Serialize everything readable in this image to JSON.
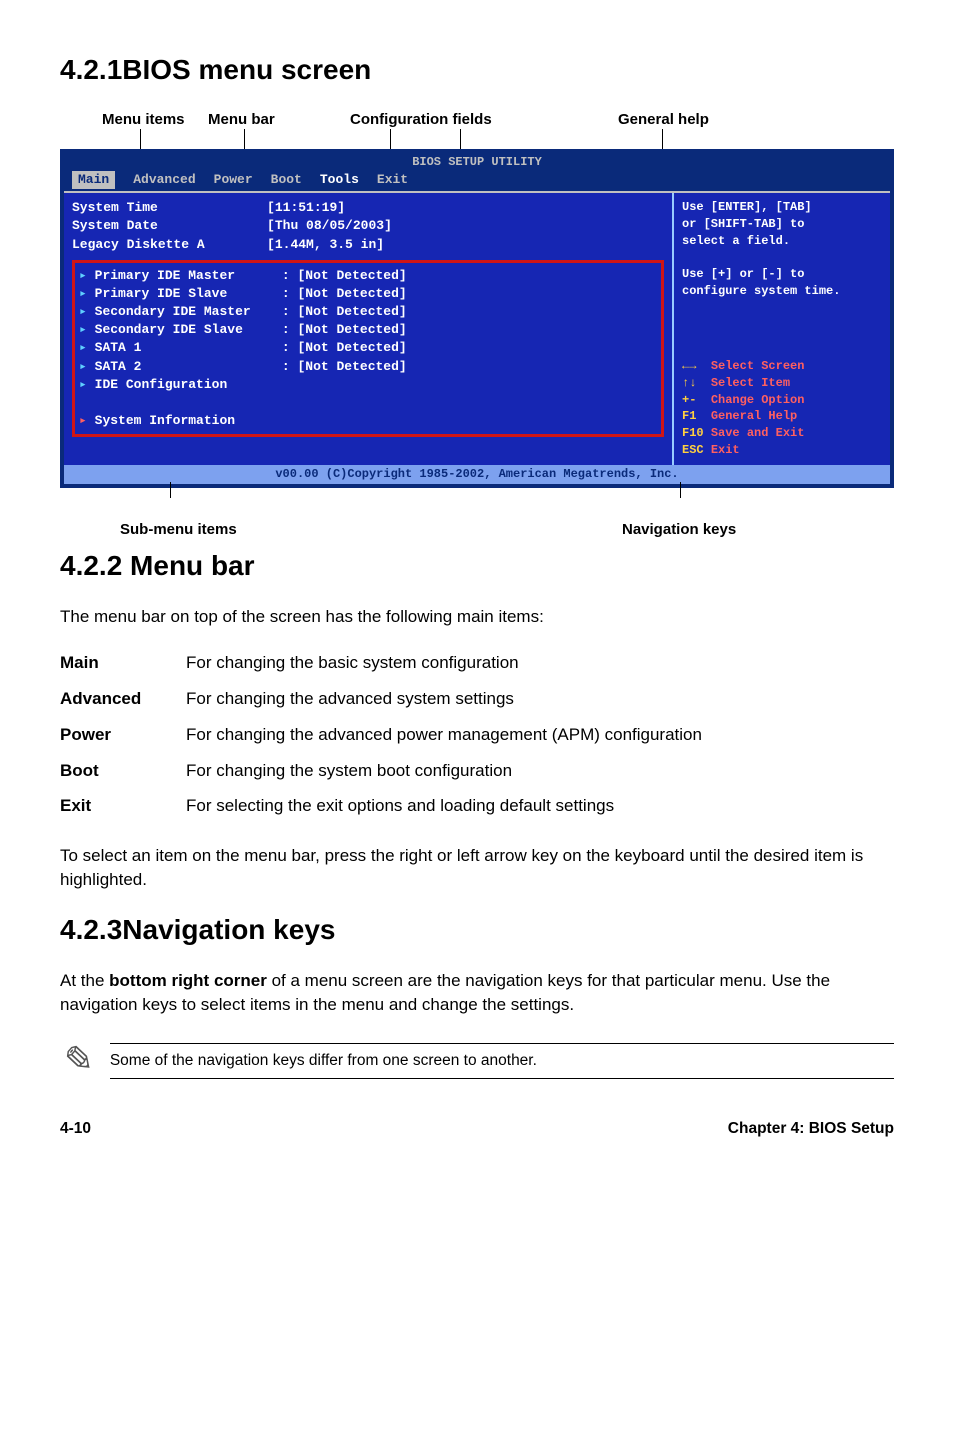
{
  "sections": {
    "s1_heading": "4.2.1BIOS menu screen",
    "s2_heading": "4.2.2  Menu bar",
    "s2_intro": "The menu bar on top of the screen has the following main items:",
    "s2_outro": "To select an item on the menu bar, press the right or left arrow key on the keyboard until the desired item is highlighted.",
    "s3_heading": "4.2.3Navigation keys",
    "s3_body": "At the bottom right corner of a menu screen are the navigation keys for that particular menu. Use the navigation keys to select items in the menu and change the settings.",
    "note": "Some of the navigation keys differ from one screen to another."
  },
  "labels": {
    "menu_items": "Menu items",
    "menu_bar": "Menu bar",
    "config_fields": "Configuration fields",
    "general_help": "General help",
    "submenu": "Sub-menu items",
    "navkeys": "Navigation keys"
  },
  "bios": {
    "title": "BIOS SETUP UTILITY",
    "menubar": [
      "Main",
      "Advanced",
      "Power",
      "Boot",
      "Tools",
      "Exit"
    ],
    "active_tab": "Main",
    "left_top": [
      {
        "label": "System Time",
        "value": "[11:51:19]"
      },
      {
        "label": "System Date",
        "value": "[Thu 08/05/2003]"
      },
      {
        "label": "Legacy Diskette A",
        "value": "[1.44M, 3.5 in]"
      }
    ],
    "left_submenu": [
      {
        "label": "Primary IDE Master",
        "value": ": [Not Detected]"
      },
      {
        "label": "Primary IDE Slave",
        "value": ": [Not Detected]"
      },
      {
        "label": "Secondary IDE Master",
        "value": ": [Not Detected]"
      },
      {
        "label": "Secondary IDE Slave",
        "value": ": [Not Detected]"
      },
      {
        "label": "SATA 1",
        "value": ": [Not Detected]"
      },
      {
        "label": "SATA 2",
        "value": ": [Not Detected]"
      },
      {
        "label": "IDE Configuration",
        "value": ""
      },
      {
        "label": "",
        "value": ""
      },
      {
        "label": "System Information",
        "value": ""
      }
    ],
    "help_top": [
      "Use [ENTER], [TAB]",
      "or [SHIFT-TAB] to",
      "select a field.",
      "",
      "Use [+] or [-] to",
      "configure system time."
    ],
    "nav": [
      {
        "key": "←→",
        "desc": "Select Screen"
      },
      {
        "key": "↑↓",
        "desc": "Select Item"
      },
      {
        "key": "+-",
        "desc": "Change Option"
      },
      {
        "key": "F1",
        "desc": "General Help"
      },
      {
        "key": "F10",
        "desc": "Save and Exit"
      },
      {
        "key": "ESC",
        "desc": "Exit"
      }
    ],
    "copyright": "v00.00 (C)Copyright 1985-2002, American Megatrends, Inc."
  },
  "menu_defs": [
    {
      "k": "Main",
      "v": "For changing the basic system configuration"
    },
    {
      "k": "Advanced",
      "v": "For changing the advanced system settings"
    },
    {
      "k": "Power",
      "v": "For changing the advanced power management (APM) configuration"
    },
    {
      "k": "Boot",
      "v": "For changing the system boot configuration"
    },
    {
      "k": "Exit",
      "v": "For selecting the exit options and loading default settings"
    }
  ],
  "s3_bold": "bottom right corner",
  "footer": {
    "page": "4-10",
    "chapter": "Chapter 4: BIOS Setup"
  }
}
